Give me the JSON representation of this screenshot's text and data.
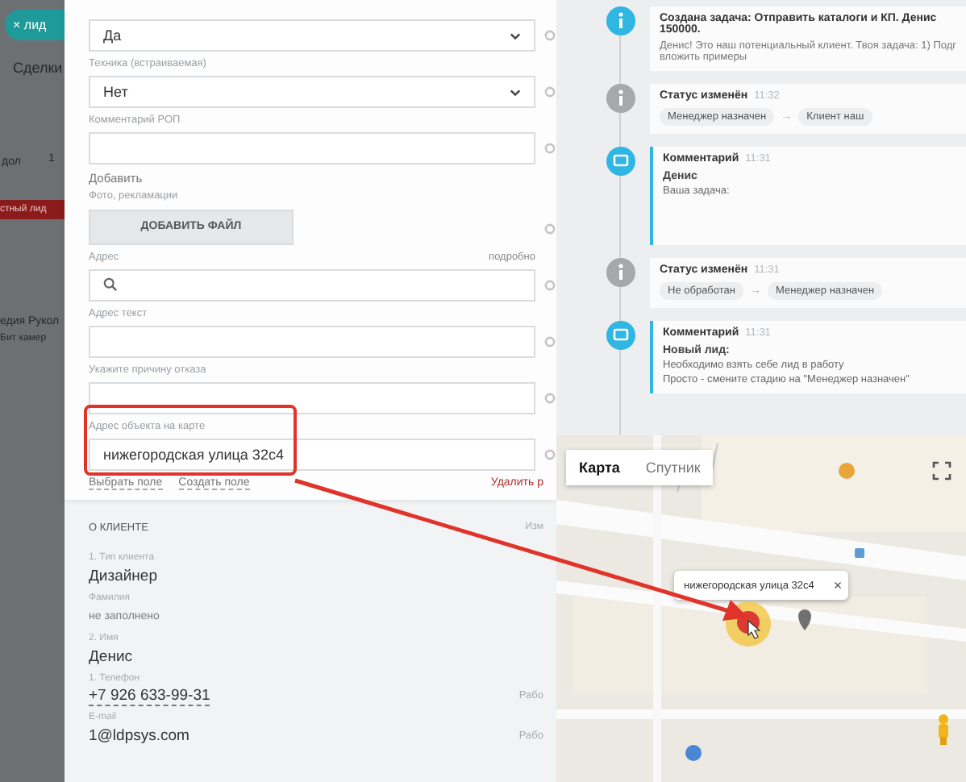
{
  "background": {
    "close_button": {
      "icon": "×",
      "label": "лид"
    },
    "texts": [
      "Сделки",
      "дол",
      "1",
      "стный лид",
      "едия Рукол",
      "Бит камер"
    ]
  },
  "form": {
    "fields": [
      {
        "kind": "select",
        "value": "Да"
      },
      {
        "kind": "select",
        "label": "Техника (встраиваемая)",
        "value": "Нет"
      },
      {
        "kind": "input",
        "label": "Комментарий РОП"
      },
      {
        "kind": "file",
        "label": "Добавить",
        "hint": "Фото, рекламации",
        "button": "ДОБАВИТЬ ФАЙЛ"
      },
      {
        "kind": "search",
        "label": "Адрес",
        "aside": "подробно"
      },
      {
        "kind": "input",
        "label": "Адрес текст"
      },
      {
        "kind": "input",
        "label": "Укажите причину отказа"
      },
      {
        "kind": "input",
        "label": "Адрес объекта на карте",
        "value": "нижегородская улица 32с4",
        "highlighted": true
      }
    ],
    "links": [
      "Выбрать поле",
      "Создать поле"
    ],
    "delete_link": "Удалить р"
  },
  "client": {
    "title": "О КЛИЕНТЕ",
    "edit": "Изм",
    "items": [
      {
        "label": "1. Тип клиента",
        "value": "Дизайнер",
        "kind": "text"
      },
      {
        "label": "Фамилия",
        "value": "не заполнено",
        "kind": "empty"
      },
      {
        "label": "2. Имя",
        "value": "Денис",
        "kind": "text"
      },
      {
        "label": "1. Телефон",
        "value": "+7 926 633-99-31",
        "kind": "phone",
        "aside": "Рабо"
      },
      {
        "label": "E-mail",
        "value": "1@ldpsys.com",
        "kind": "text",
        "aside": "Рабо"
      }
    ]
  },
  "timeline": [
    {
      "kind": "task",
      "title": "Создана задача: Отправить каталоги и КП. Денис 150000.",
      "text": "Денис! Это наш потенциальный клиент. Твоя задача: 1) Подг вложить примеры"
    },
    {
      "kind": "status",
      "title": "Статус изменён",
      "time": "11:32",
      "from": "Менеджер назначен",
      "arrow": "→",
      "to": "Клиент наш"
    },
    {
      "kind": "comment",
      "title": "Комментарий",
      "time": "11:31",
      "heading": "Денис",
      "body": [
        "Ваша задача:"
      ]
    },
    {
      "kind": "status",
      "title": "Статус изменён",
      "time": "11:31",
      "from": "Не обработан",
      "arrow": "→",
      "to": "Менеджер назначен"
    },
    {
      "kind": "comment",
      "title": "Комментарий",
      "time": "11:31",
      "heading": "Новый лид:",
      "body": [
        "Необходимо взять себе лид в работу",
        "Просто - смените стадию на \"Менеджер назначен\""
      ]
    }
  ],
  "map": {
    "tabs": [
      {
        "label": "Карта",
        "selected": true
      },
      {
        "label": "Спутник",
        "selected": false
      }
    ],
    "info_window": {
      "text": "нижегородская улица 32с4",
      "close": "×"
    }
  }
}
